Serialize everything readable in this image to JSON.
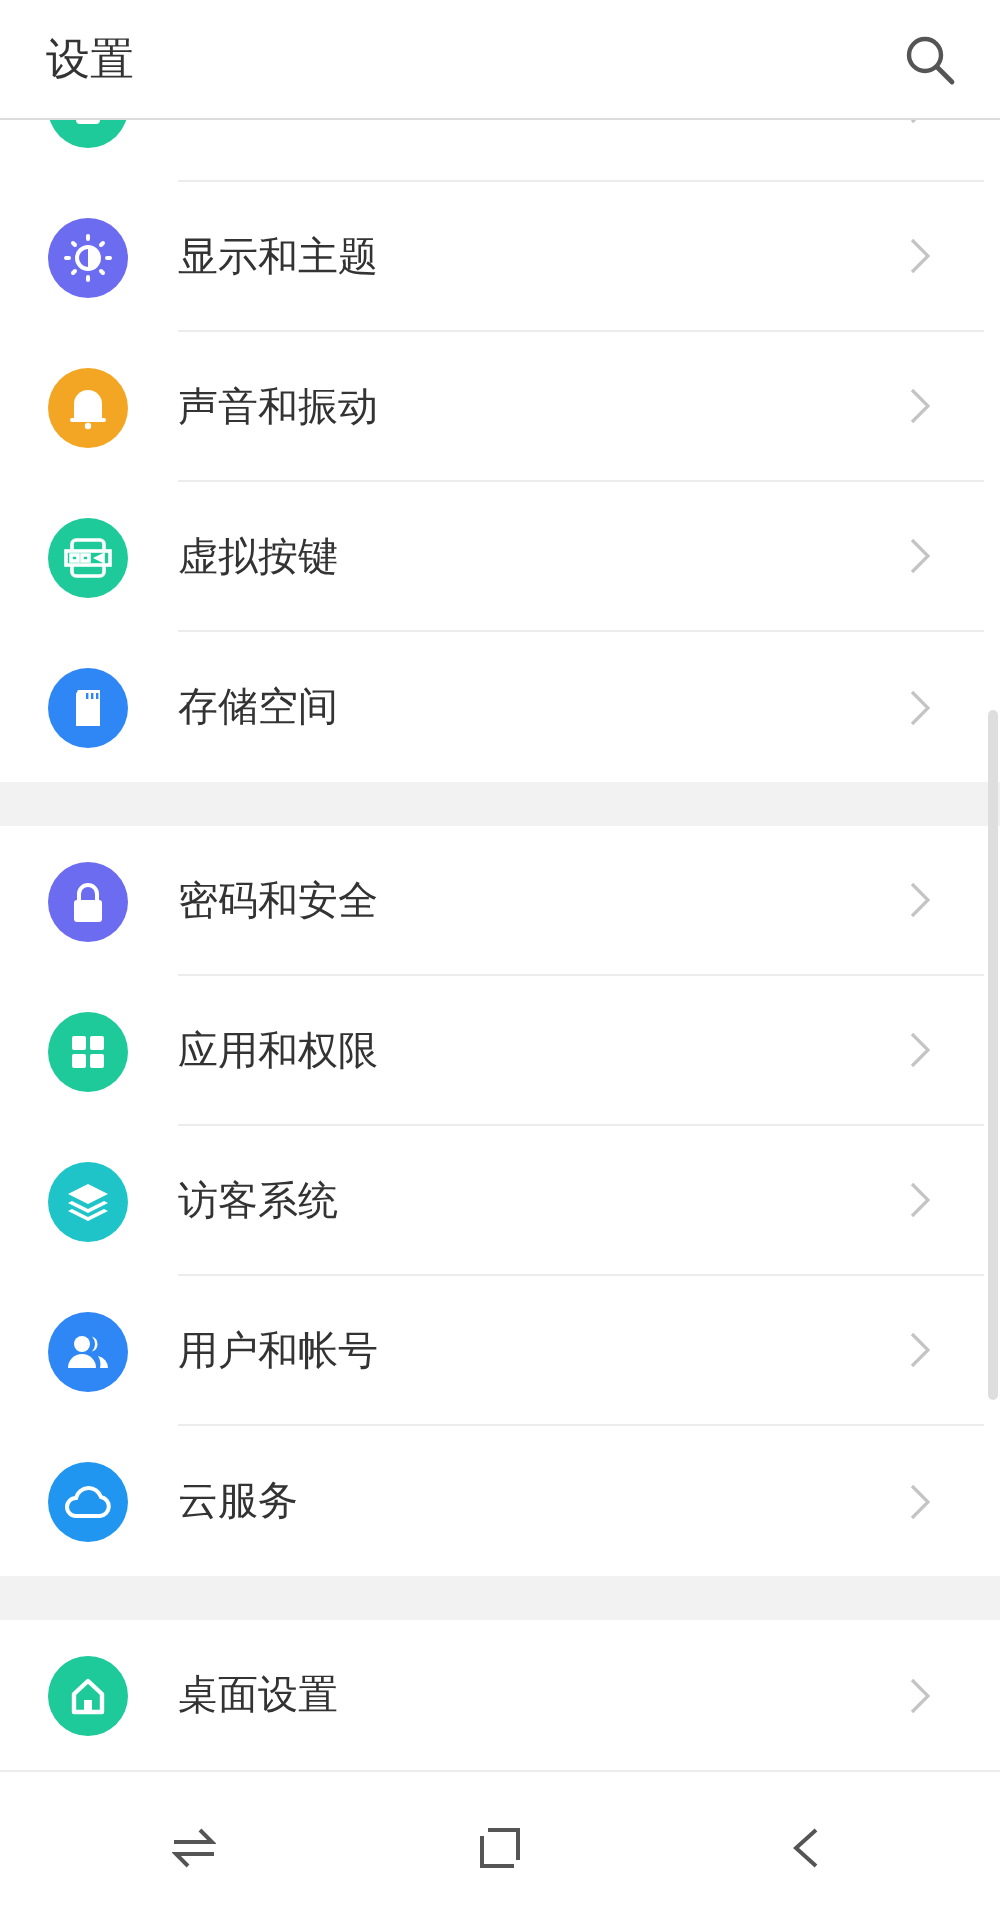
{
  "title": "设置",
  "partial_item": {
    "color": "#1ec99a"
  },
  "groups": [
    {
      "items": [
        {
          "label": "显示和主题",
          "kind": "display",
          "color": "#6b6cf0"
        },
        {
          "label": "声音和振动",
          "kind": "bell",
          "color": "#f3a623"
        },
        {
          "label": "虚拟按键",
          "kind": "keys",
          "color": "#1ec99a"
        },
        {
          "label": "存储空间",
          "kind": "storage",
          "color": "#2f86f5"
        }
      ]
    },
    {
      "items": [
        {
          "label": "密码和安全",
          "kind": "lock",
          "color": "#6b6cf0"
        },
        {
          "label": "应用和权限",
          "kind": "apps",
          "color": "#1ec99a"
        },
        {
          "label": "访客系统",
          "kind": "layers",
          "color": "#1ec4c8"
        },
        {
          "label": "用户和帐号",
          "kind": "users",
          "color": "#2f86f5"
        },
        {
          "label": "云服务",
          "kind": "cloud",
          "color": "#2196f0"
        }
      ]
    },
    {
      "items": [
        {
          "label": "桌面设置",
          "kind": "home",
          "color": "#1ec99a"
        }
      ]
    }
  ],
  "nav": [
    {
      "kind": "switch"
    },
    {
      "kind": "square"
    },
    {
      "kind": "back"
    }
  ]
}
